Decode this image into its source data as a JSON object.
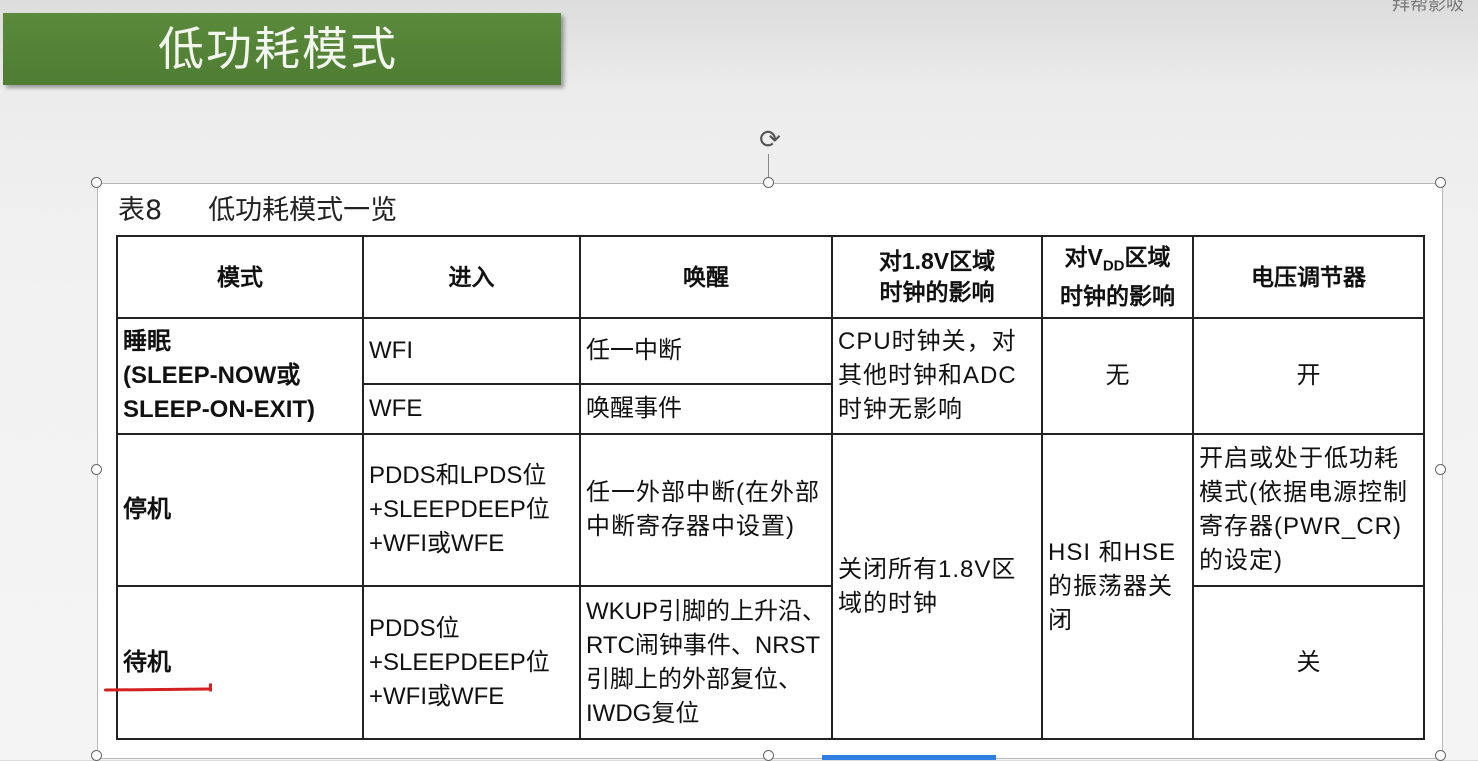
{
  "slide": {
    "title": "低功耗模式",
    "corner_text": "拜帮影吸"
  },
  "caption": {
    "number": "表8",
    "text": "低功耗模式一览"
  },
  "table": {
    "headers": {
      "mode": "模式",
      "enter": "进入",
      "wake": "唤醒",
      "clock18_line1": "对1.8V区域",
      "clock18_line2": "时钟的影响",
      "vdd_pre": "对V",
      "vdd_sub": "DD",
      "vdd_post": "区域",
      "vdd_line2": "时钟的影响",
      "regulator": "电压调节器"
    },
    "sleep": {
      "mode_line1": "睡眠",
      "mode_line2": "(SLEEP-NOW或",
      "mode_line3": "SLEEP-ON-EXIT)",
      "enter_wfi": "WFI",
      "wake_wfi": "任一中断",
      "enter_wfe": "WFE",
      "wake_wfe": "唤醒事件",
      "clock18": "CPU时钟关，对其他时钟和ADC时钟无影响",
      "vdd": "无",
      "regulator": "开"
    },
    "stop": {
      "mode": "停机",
      "enter": "PDDS和LPDS位+SLEEPDEEP位+WFI或WFE",
      "wake": "任一外部中断(在外部中断寄存器中设置)",
      "regulator": "开启或处于低功耗模式(依据电源控制寄存器(PWR_CR)的设定)"
    },
    "stop_standby_shared": {
      "clock18": "关闭所有1.8V区域的时钟",
      "vdd": "HSI 和HSE的振荡器关闭"
    },
    "standby": {
      "mode": "待机",
      "enter": "PDDS位+SLEEPDEEP位+WFI或WFE",
      "wake": "WKUP引脚的上升沿、RTC闹钟事件、NRST引脚上的外部复位、IWDG复位",
      "regulator": "关"
    }
  }
}
